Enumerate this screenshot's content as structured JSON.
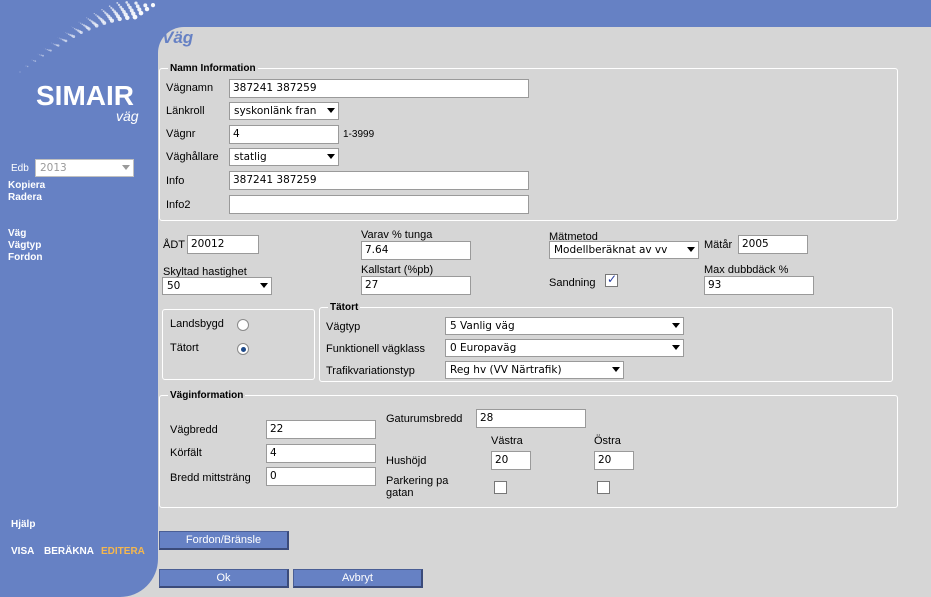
{
  "app": {
    "logo_title": "SIMAIR",
    "logo_subtitle": "väg"
  },
  "sidebar": {
    "edb_label": "Edb",
    "edb_value": "2013",
    "copy_label": "Kopiera",
    "delete_label": "Radera",
    "nav": [
      "Väg",
      "Vägtyp",
      "Fordon"
    ],
    "help_label": "Hjälp",
    "modes": [
      "VISA",
      "BERÄKNA",
      "EDITERA"
    ],
    "active_mode": "EDITERA",
    "colors": {
      "background": "#6681c4",
      "active": "#f5b74e"
    }
  },
  "page": {
    "title": "Väg"
  },
  "name_info": {
    "legend": "Namn Information",
    "road_name_label": "Vägnamn",
    "road_name_value": "387241 387259",
    "link_role_label": "Länkroll",
    "link_role_value": "syskonlänk fran",
    "road_no_label": "Vägnr",
    "road_no_value": "4",
    "road_no_range": "1-3999",
    "holder_label": "Väghållare",
    "holder_value": "statlig",
    "info_label": "Info",
    "info_value": "387241 387259",
    "info2_label": "Info2",
    "info2_value": ""
  },
  "traffic": {
    "adt_label": "ÅDT",
    "adt_value": "20012",
    "heavy_label": "Varav % tunga",
    "heavy_value": "7.64",
    "method_label": "Mätmetod",
    "method_value": "Modellberäknat av vv",
    "year_label": "Mätår",
    "year_value": "2005",
    "speed_label": "Skyltad hastighet",
    "speed_value": "50",
    "coldstart_label": "Kallstart (%pb)",
    "coldstart_value": "27",
    "sanding_label": "Sandning",
    "sanding_checked": true,
    "studded_label": "Max dubbdäck %",
    "studded_value": "93"
  },
  "area": {
    "rural_label": "Landsbygd",
    "urban_label": "Tätort",
    "selected": "Tätort"
  },
  "urban": {
    "legend": "Tätort",
    "road_type_label": "Vägtyp",
    "road_type_value": "5 Vanlig väg",
    "func_class_label": "Funktionell vägklass",
    "func_class_value": "0 Europaväg",
    "traffic_var_label": "Trafikvariationstyp",
    "traffic_var_value": "Reg hv (VV Närtrafik)"
  },
  "road_info": {
    "legend": "Väginformation",
    "street_width_label": "Gaturumsbredd",
    "street_width_value": "28",
    "road_width_label": "Vägbredd",
    "road_width_value": "22",
    "lanes_label": "Körfält",
    "lanes_value": "4",
    "median_label": "Bredd mittsträng",
    "median_value": "0",
    "west_label": "Västra",
    "east_label": "Östra",
    "house_height_label": "Hushöjd",
    "house_height_west": "20",
    "house_height_east": "20",
    "parking_label_1": "Parkering pa",
    "parking_label_2": "gatan",
    "parking_west": false,
    "parking_east": false
  },
  "buttons": {
    "vehicle_fuel": "Fordon/Bränsle",
    "ok": "Ok",
    "cancel": "Avbryt"
  }
}
